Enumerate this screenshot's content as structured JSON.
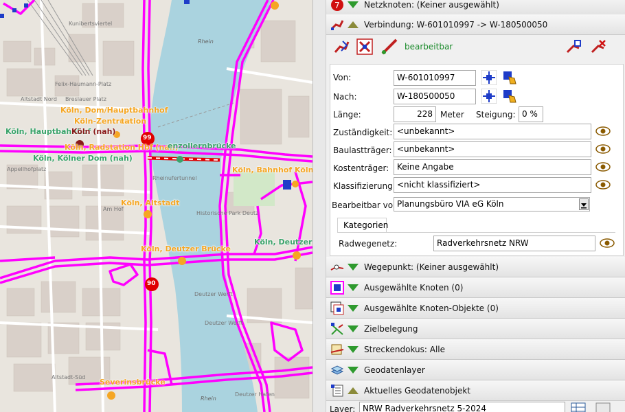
{
  "map": {
    "labels_orange": [
      "Köln, Dom/Hauptbahnhof",
      "Köln-Zentrum",
      "Köln, Radstation Hbf (nah)",
      "Köln, Altstadt",
      "Köln, Deutzer Brücke",
      "Köln, Bahnhof Köln",
      "Severinsbrücke",
      "tation"
    ],
    "labels_green": [
      "Köln, Hauptbahnhof",
      "Köln, Kölner Dom (nah)",
      "Köln, Deutzer",
      "enzollernbrücke"
    ],
    "label_dark": "Köln (nah)",
    "streets": [
      "Altstadt Nord",
      "Appellhofplatz",
      "Historische Park Deutz",
      "Deutzer Werft",
      "Deutzer Werft",
      "Altstadt-Süd",
      "Deutzer Hafen",
      "Rhein",
      "Rhein",
      "Rheinufertunnel",
      "Breslauer Platz",
      "Felix-Haumann-Platz",
      "Am Hof",
      "Kunibertsviertel"
    ],
    "markers": [
      "99",
      "90"
    ]
  },
  "panel": {
    "sections": {
      "netzknoten": "Netzknoten: (Keiner ausgewählt)",
      "verbindung": "Verbindung: W-601010997 -> W-180500050",
      "wegepunkt": "Wegepunkt: (Keiner ausgewählt)",
      "knoten": "Ausgewählte Knoten (0)",
      "knoten_objekte": "Ausgewählte Knoten-Objekte (0)",
      "zielbelegung": "Zielbelegung",
      "streckendokus": "Streckendokus: Alle",
      "geodatenlayer": "Geodatenlayer",
      "geodatenobjekt": "Aktuelles Geodatenobjekt"
    },
    "toolbar": {
      "edit_state": "bearbeitbar"
    },
    "form": {
      "von_label": "Von:",
      "von_value": "W-601010997",
      "nach_label": "Nach:",
      "nach_value": "W-180500050",
      "laenge_label": "Länge:",
      "laenge_value": "228",
      "laenge_unit": "Meter",
      "steigung_label": "Steigung:",
      "steigung_value": "0 %",
      "zust_label": "Zuständigkeit:",
      "zust_value": "<unbekannt>",
      "baulast_label": "Baulastträger:",
      "baulast_value": "<unbekannt>",
      "kosten_label": "Kostenträger:",
      "kosten_value": "Keine Angabe",
      "klass_label": "Klassifizierung:",
      "klass_value": "<nicht klassifiziert>",
      "bearb_label": "Bearbeitbar von:",
      "bearb_value": "Planungsbüro VIA eG Köln",
      "tab_label": "Kategorien",
      "radnetz_label": "Radwegenetz:",
      "radnetz_value": "Radverkehrsnetz NRW"
    },
    "layer": {
      "label": "Layer:",
      "value": "NRW Radverkehrsnetz 5-2024"
    }
  },
  "colors": {
    "network": "#ff00ff",
    "river": "#aad3df",
    "station_orange": "#f5a623",
    "edit_green": "#1a8a2a"
  }
}
